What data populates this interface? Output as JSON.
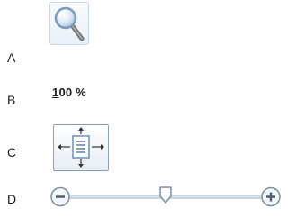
{
  "labels": {
    "a": "A",
    "b": "B",
    "c": "C",
    "d": "D"
  },
  "zoom_button": {
    "icon": "magnifier-icon"
  },
  "zoom_percentage": {
    "accelerator": "1",
    "rest": "00 %"
  },
  "fit_page_button": {
    "icon": "fit-page-icon"
  },
  "zoom_slider": {
    "decrease_icon": "zoom-out-minus-icon",
    "increase_icon": "zoom-in-plus-icon",
    "thumb_position_fraction": 0.5
  },
  "colors": {
    "button_border": "#c9d6e6",
    "slider_track": "#9fb2c8",
    "thumb_border": "#7c8fa6"
  }
}
